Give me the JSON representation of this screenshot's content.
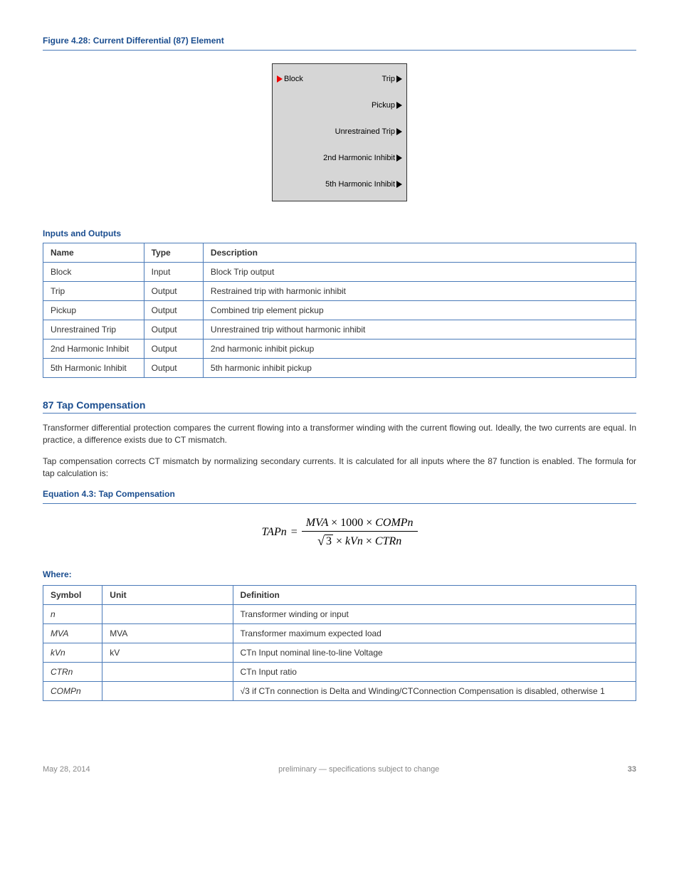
{
  "figure": {
    "title": "Figure 4.28: Current Differential (87) Element",
    "block_input": "Block",
    "outputs": [
      "Trip",
      "Pickup",
      "Unrestrained Trip",
      "2nd Harmonic Inhibit",
      "5th Harmonic Inhibit"
    ]
  },
  "ports_table": {
    "title": "Inputs and Outputs",
    "headers": {
      "name": "Name",
      "type": "Type",
      "desc": "Description"
    },
    "rows": [
      {
        "name": "Block",
        "type": "Input",
        "desc": "Block Trip output"
      },
      {
        "name": "Trip",
        "type": "Output",
        "desc": "Restrained trip with harmonic inhibit"
      },
      {
        "name": "Pickup",
        "type": "Output",
        "desc": "Combined trip element pickup"
      },
      {
        "name": "Unrestrained Trip",
        "type": "Output",
        "desc": "Unrestrained trip without harmonic inhibit"
      },
      {
        "name": "2nd Harmonic Inhibit",
        "type": "Output",
        "desc": "2nd harmonic inhibit pickup"
      },
      {
        "name": "5th Harmonic Inhibit",
        "type": "Output",
        "desc": "5th harmonic inhibit pickup"
      }
    ]
  },
  "section": {
    "heading": "87 Tap Compensation",
    "para1": "Transformer differential protection compares the current flowing into a transformer winding with the current flowing out. Ideally, the two currents are equal.  In practice, a difference exists due to CT mismatch.",
    "para2": "Tap compensation corrects CT mismatch by normalizing secondary currents. It is calculated for all inputs where the 87 function is enabled.  The formula for tap calculation is:",
    "eq_title": "Equation 4.3: Tap Compensation",
    "eq": {
      "lhs": "TAPn",
      "num": [
        "MVA",
        "1000",
        "COMPn"
      ],
      "den_pre_sqrt": "3",
      "den_rest": [
        "kVn",
        "CTRn"
      ]
    },
    "where_title": "Where:",
    "where_headers": {
      "sym": "Symbol",
      "unit": "Unit",
      "desc": "Definition"
    },
    "where_rows": [
      {
        "sym": "n",
        "unit": "",
        "desc": "Transformer winding or input"
      },
      {
        "sym": "MVA",
        "unit": "MVA",
        "desc": "Transformer maximum expected load"
      },
      {
        "sym": "kVn",
        "unit": "kV",
        "desc": "CTn Input nominal line-to-line Voltage"
      },
      {
        "sym": "CTRn",
        "unit": "",
        "desc": "CTn Input ratio"
      },
      {
        "sym": "COMPn",
        "unit": "",
        "desc": "√3 if CTn connection is Delta and Winding/CTConnection Compensation is disabled, otherwise 1",
        "has_sqrt": true,
        "desc_plain_after_sqrt": "3 if CTn connection is Delta and Winding/CTConnection Compensation is disabled, otherwise 1"
      }
    ]
  },
  "footer": {
    "date": "May 28, 2014",
    "mid": "preliminary — specifications subject to change",
    "page": "33"
  }
}
